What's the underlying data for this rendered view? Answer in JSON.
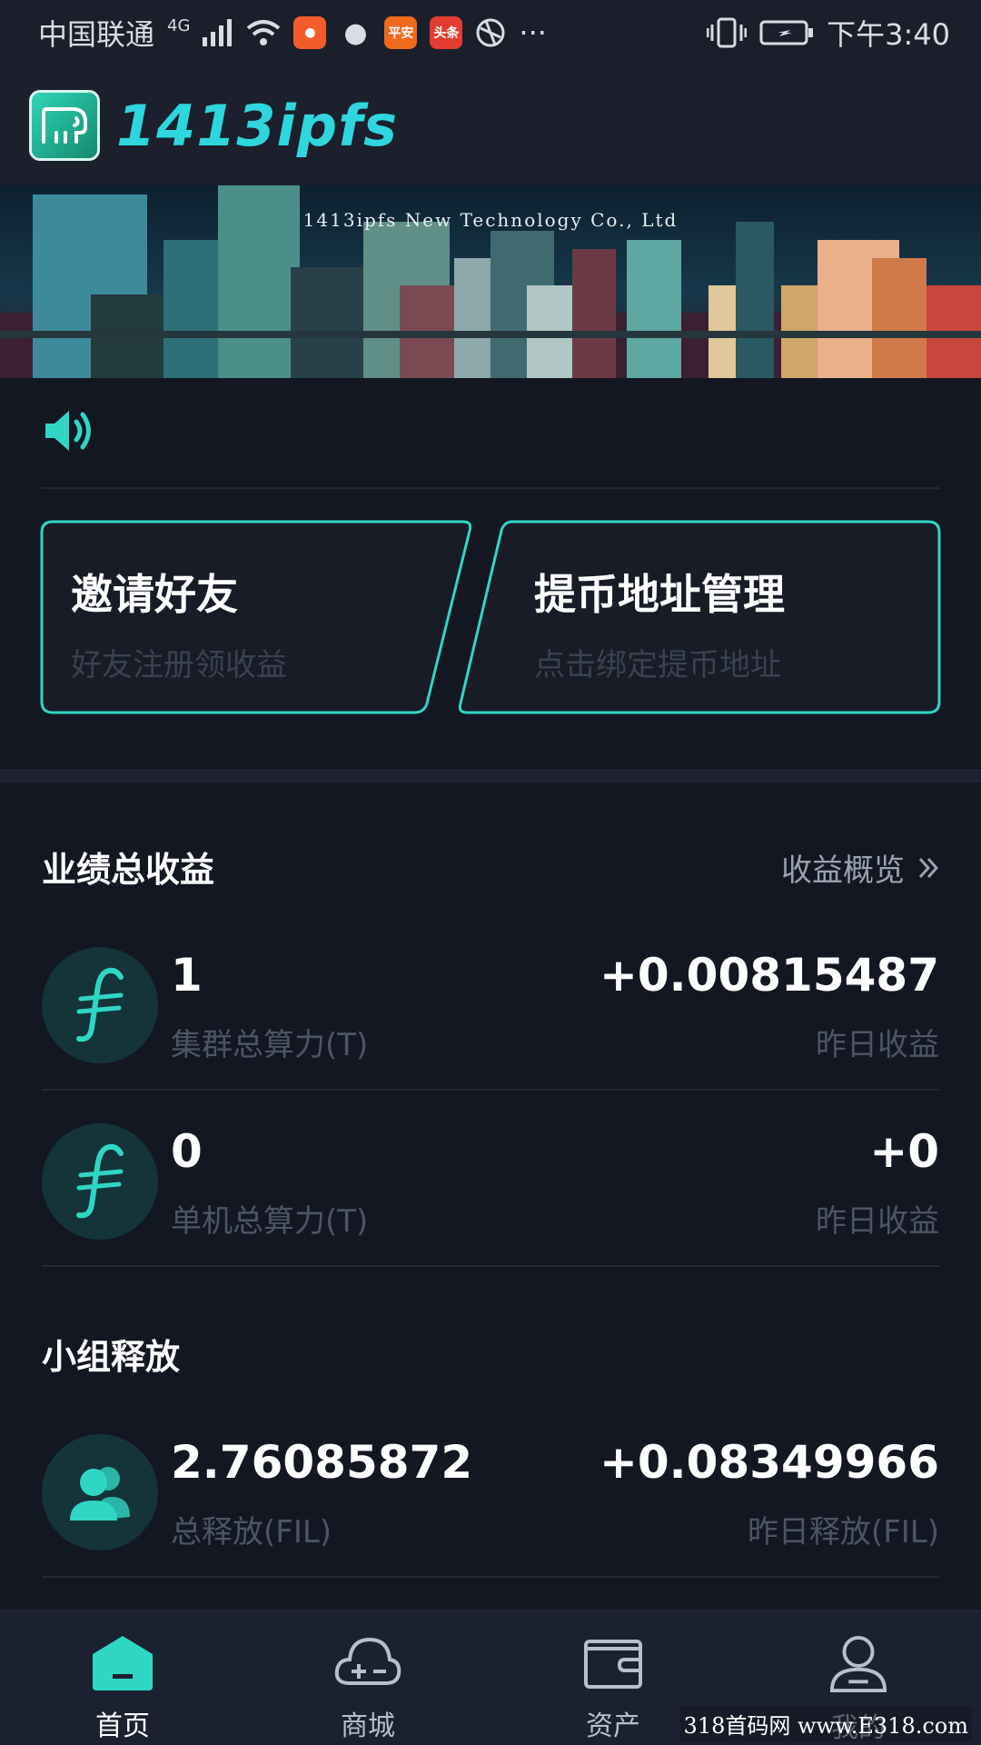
{
  "status_bar": {
    "carrier": "中国联通",
    "network": "4G",
    "apps": [
      {
        "name": "kuaishou-icon",
        "color": "#f25b2a",
        "label": ""
      },
      {
        "name": "message-icon",
        "color": "#d9dce2",
        "label": ""
      },
      {
        "name": "pingan-icon",
        "color": "#f06a1e",
        "label": "平安"
      },
      {
        "name": "toutiao-icon",
        "color": "#e33c31",
        "label": "头条"
      },
      {
        "name": "browser-icon",
        "color": "#d9dce2",
        "label": ""
      }
    ],
    "more": "···",
    "time": "下午3:40"
  },
  "header": {
    "app_name": "1413ipfs"
  },
  "banner": {
    "caption": "1413ipfs New Technology Co., Ltd"
  },
  "actions": [
    {
      "title": "邀请好友",
      "subtitle": "好友注册领收益"
    },
    {
      "title": "提币地址管理",
      "subtitle": "点击绑定提币地址"
    }
  ],
  "earnings": {
    "title": "业绩总收益",
    "overview_label": "收益概览",
    "rows": [
      {
        "icon": "filecoin-icon",
        "value": "1",
        "label": "集群总算力(T)",
        "right_value": "+0.00815487",
        "right_label": "昨日收益"
      },
      {
        "icon": "filecoin-icon",
        "value": "0",
        "label": "单机总算力(T)",
        "right_value": "+0",
        "right_label": "昨日收益"
      }
    ]
  },
  "group_release": {
    "title": "小组释放",
    "row": {
      "icon": "users-icon",
      "value": "2.76085872",
      "label": "总释放(FIL)",
      "right_value": "+0.08349966",
      "right_label": "昨日释放(FIL)"
    }
  },
  "tabs": [
    {
      "label": "首页",
      "icon": "home-icon",
      "active": true
    },
    {
      "label": "商城",
      "icon": "cloud-add-icon",
      "active": false
    },
    {
      "label": "资产",
      "icon": "wallet-icon",
      "active": false
    },
    {
      "label": "我的",
      "icon": "profile-icon",
      "active": false
    }
  ],
  "watermark": "318首码网 www.E318.com",
  "colors": {
    "accent": "#2fd6c4",
    "background": "#131722"
  }
}
